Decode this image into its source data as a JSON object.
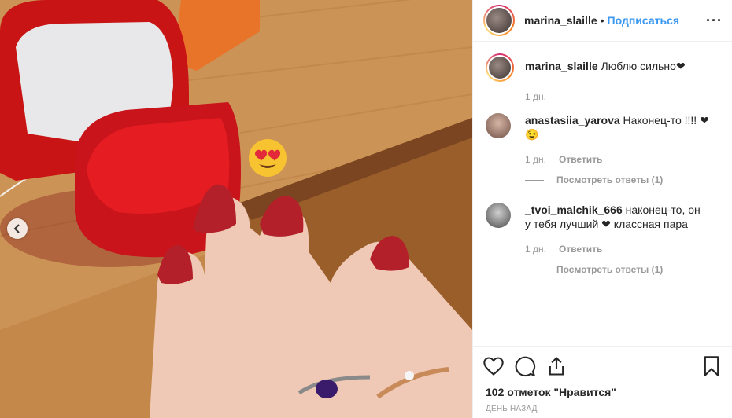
{
  "post": {
    "username": "marina_slaille",
    "separator": "•",
    "follow_label": "Подписаться",
    "more_label": "···",
    "caption": "Люблю сильно❤",
    "caption_time": "1 дн."
  },
  "comments": [
    {
      "username": "anastasiia_yarova",
      "text": "Наконец-то !!!! ❤ 😉",
      "time": "1 дн.",
      "reply_label": "Ответить",
      "view_replies": "Посмотреть ответы (1)"
    },
    {
      "username": "_tvoi_malchik_666",
      "text": "наконец-то, он у тебя лучший ❤ классная пара",
      "time": "1 дн.",
      "reply_label": "Ответить",
      "view_replies": "Посмотреть ответы (1)"
    }
  ],
  "footer": {
    "likes": "102 отметок \"Нравится\"",
    "date": "ДЕНЬ НАЗАД"
  },
  "icons": [
    "heart-icon",
    "comment-icon",
    "share-icon",
    "bookmark-icon",
    "chevron-left-icon"
  ],
  "colors": {
    "link": "#3897f0",
    "text": "#262626",
    "muted": "#999999",
    "border": "#efefef"
  }
}
